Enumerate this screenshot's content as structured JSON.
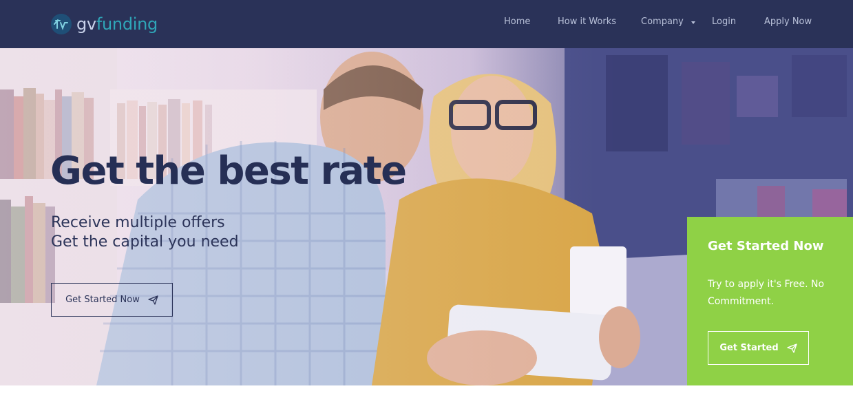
{
  "brand": {
    "name_part1": "gv",
    "name_part2": "funding",
    "logo_icon": "gv-logo-icon"
  },
  "nav": {
    "items": [
      {
        "label": "Home"
      },
      {
        "label": "How it Works"
      },
      {
        "label": "Company",
        "has_dropdown": true
      },
      {
        "label": "Login"
      },
      {
        "label": "Apply Now"
      }
    ]
  },
  "hero": {
    "title": "Get the best rate",
    "subtitle_line1": "Receive multiple offers",
    "subtitle_line2": "Get the capital you need",
    "button_label": "Get Started Now",
    "button_icon": "paper-plane-icon"
  },
  "cta": {
    "title": "Get Started Now",
    "text": "Try to apply it's Free. No Commitment.",
    "button_label": "Get Started",
    "button_icon": "paper-plane-icon"
  },
  "colors": {
    "nav_bg": "#2a3258",
    "accent_green": "#8fd146",
    "brand_teal": "#2fa6b8",
    "hero_text": "#262f55"
  }
}
